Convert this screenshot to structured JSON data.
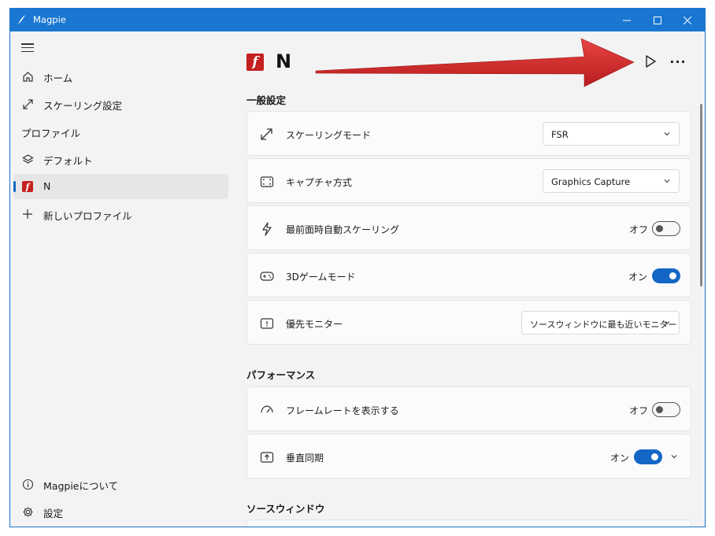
{
  "window": {
    "title": "Magpie",
    "accent": "#1977d2"
  },
  "sidebar": {
    "home_label": "ホーム",
    "scaling_settings_label": "スケーリング設定",
    "profiles_caption": "プロファイル",
    "default_profile_label": "デフォルト",
    "profile_n_label": "N",
    "new_profile_label": "新しいプロファイル",
    "about_label": "Magpieについて",
    "settings_label": "設定"
  },
  "header": {
    "title": "N",
    "icon": "flash-player-icon"
  },
  "general": {
    "title": "一般設定",
    "scaling_mode": {
      "label": "スケーリングモード",
      "value": "FSR",
      "icon": "resize-diagonal-icon"
    },
    "capture_method": {
      "label": "キャプチャ方式",
      "value": "Graphics Capture",
      "icon": "screen-capture-icon"
    },
    "auto_scale": {
      "label": "最前面時自動スケーリング",
      "state": "オフ",
      "on": false,
      "icon": "lightning-icon"
    },
    "game_mode": {
      "label": "3Dゲームモード",
      "state": "オン",
      "on": true,
      "icon": "gamepad-icon"
    },
    "preferred_monitor": {
      "label": "優先モニター",
      "value": "ソースウィンドウに最も近いモニター",
      "icon": "monitor-icon"
    }
  },
  "performance": {
    "title": "パフォーマンス",
    "show_fps": {
      "label": "フレームレートを表示する",
      "state": "オフ",
      "on": false,
      "icon": "speedometer-icon"
    },
    "vsync": {
      "label": "垂直同期",
      "state": "オン",
      "on": true,
      "icon": "vsync-icon"
    }
  },
  "source_window": {
    "title": "ソースウィンドウ"
  },
  "annotation": {
    "arrow_color": "#d42a2a"
  }
}
